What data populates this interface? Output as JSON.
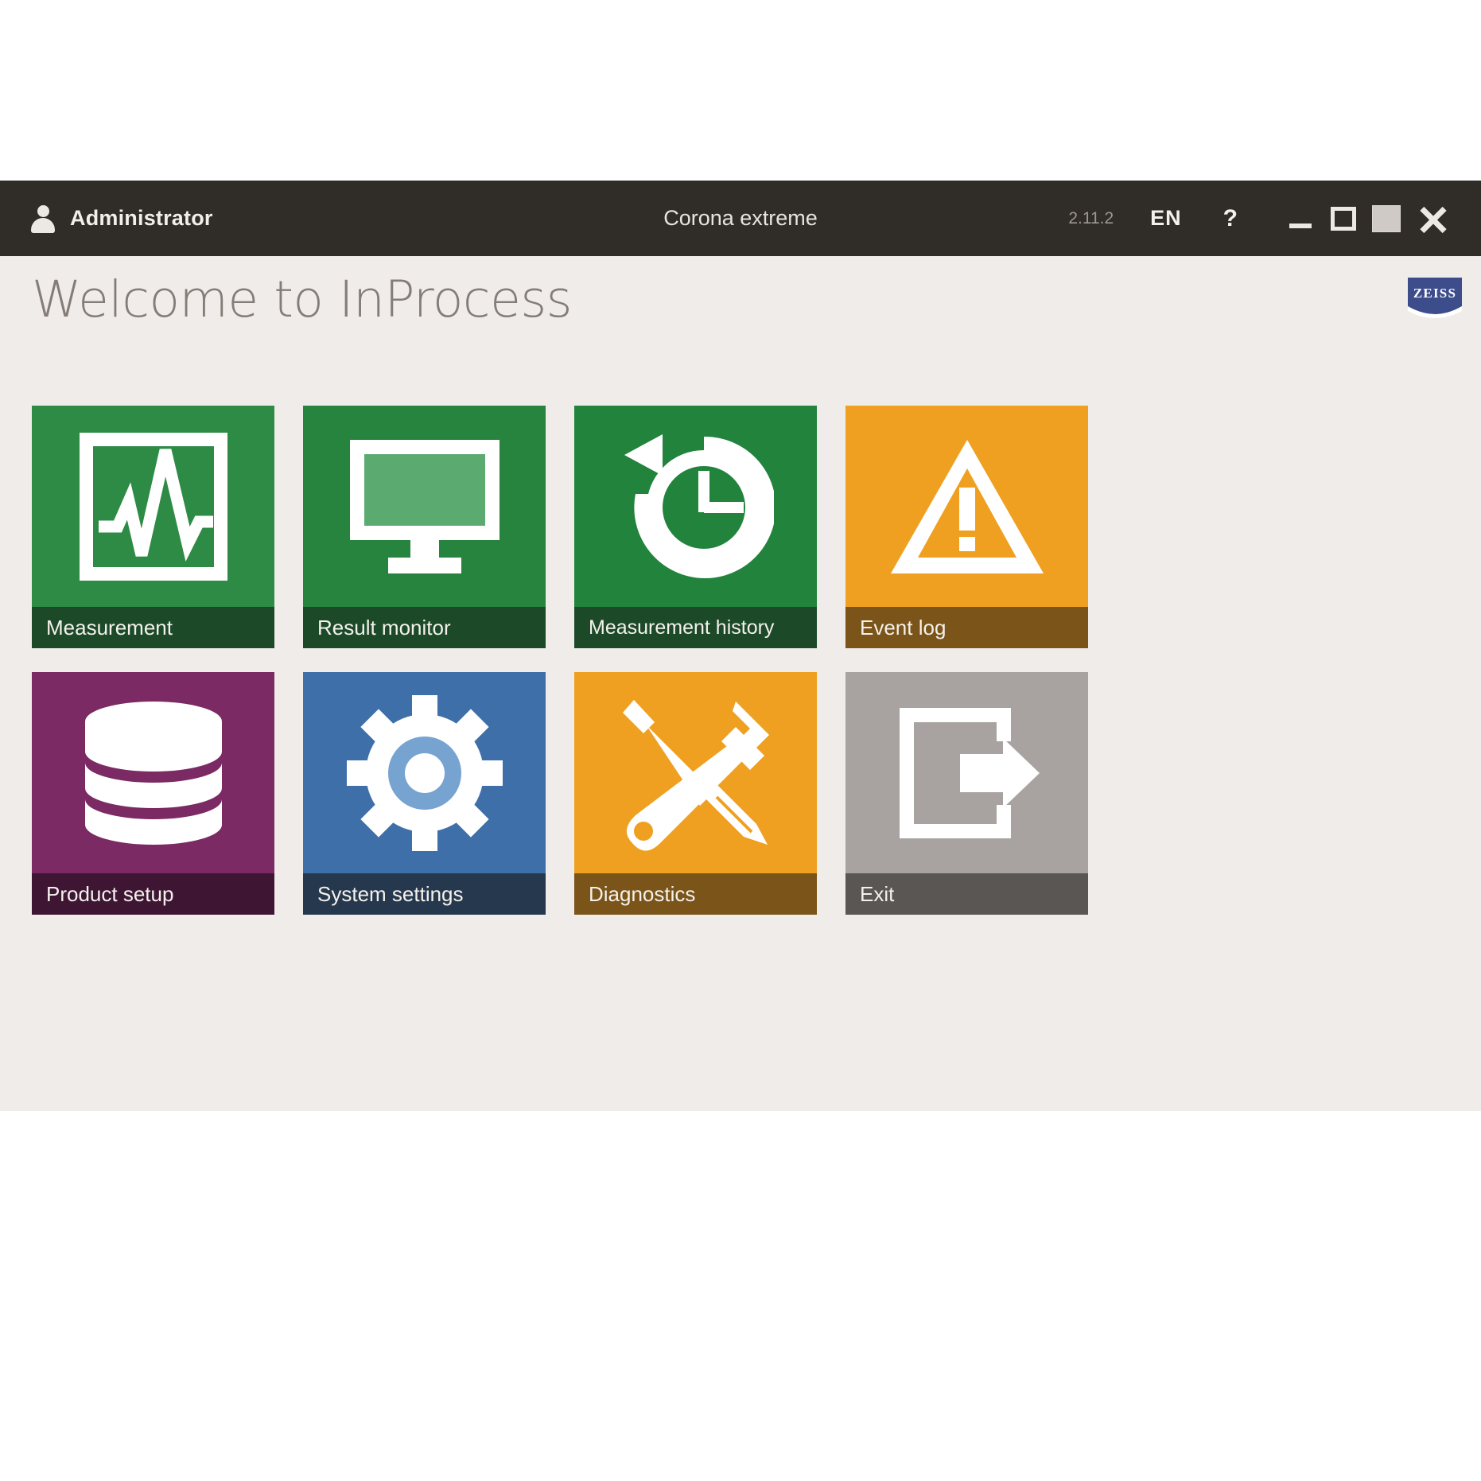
{
  "titlebar": {
    "user_icon": "user-icon",
    "user_name": "Administrator",
    "window_title": "Corona extreme",
    "version": "2.11.2",
    "language": "EN",
    "help": "?",
    "minimize_icon": "minimize-icon",
    "maximize_icon": "maximize-icon",
    "restore_icon": "restore-icon",
    "close_icon": "close-icon",
    "bg_color": "#302c28"
  },
  "header": {
    "title": "Welcome to InProcess",
    "title_color": "#847d77",
    "brand": "ZEISS",
    "brand_color": "#3d4d8c",
    "background": "#f0ece9"
  },
  "tiles": [
    {
      "label": "Measurement",
      "icon": "waveform-in-square-icon",
      "color": "#2e8b46",
      "label_color": "#1c4a29"
    },
    {
      "label": "Result monitor",
      "icon": "monitor-icon",
      "color": "#26843e",
      "label_color": "#1c4a29"
    },
    {
      "label": "Measurement history",
      "icon": "clock-history-icon",
      "color": "#22833c",
      "label_color": "#1c4a29"
    },
    {
      "label": "Event log",
      "icon": "warning-triangle-icon",
      "color": "#efa021",
      "label_color": "#7a5418"
    },
    {
      "label": "Product setup",
      "icon": "database-icon",
      "color": "#7b2a63",
      "label_color": "#3e1634"
    },
    {
      "label": "System settings",
      "icon": "gear-icon",
      "color": "#3f6fa8",
      "label_color": "#26384d"
    },
    {
      "label": "Diagnostics",
      "icon": "wrench-screwdriver-icon",
      "color": "#efa021",
      "label_color": "#7a5418"
    },
    {
      "label": "Exit",
      "icon": "exit-door-arrow-icon",
      "color": "#a8a3a0",
      "label_color": "#5a5654"
    }
  ]
}
